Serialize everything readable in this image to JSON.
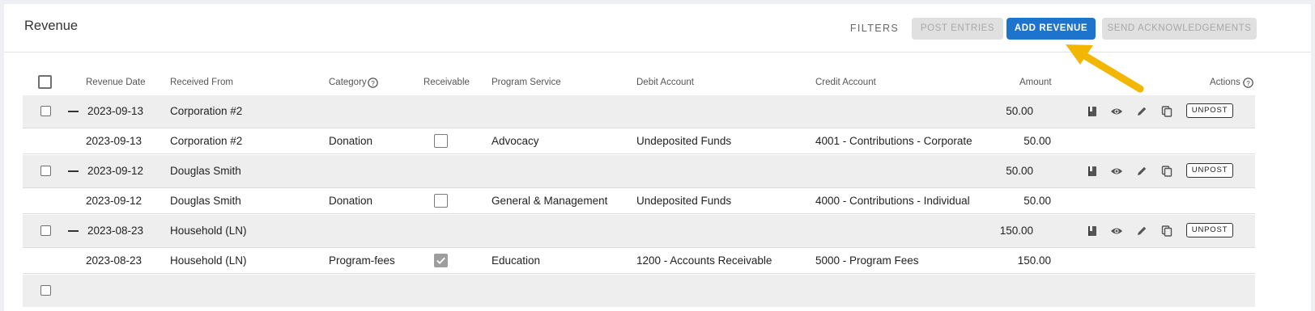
{
  "header": {
    "title": "Revenue",
    "filters_label": "FILTERS",
    "post_entries_label": "POST ENTRIES",
    "add_revenue_label": "ADD REVENUE",
    "send_ack_label": "SEND ACKNOWLEDGEMENTS"
  },
  "table": {
    "columns": {
      "revenue_date": "Revenue Date",
      "received_from": "Received From",
      "category": "Category",
      "receivable": "Receivable",
      "program_service": "Program Service",
      "debit_account": "Debit Account",
      "credit_account": "Credit Account",
      "amount": "Amount",
      "actions": "Actions"
    },
    "unpost_label": "UNPOST",
    "groups": [
      {
        "date": "2023-09-13",
        "from": "Corporation #2",
        "amount": "50.00",
        "detail": {
          "date": "2023-09-13",
          "from": "Corporation #2",
          "category": "Donation",
          "receivable": false,
          "program": "Advocacy",
          "debit": "Undeposited Funds",
          "credit": "4001 - Contributions - Corporate",
          "amount": "50.00"
        }
      },
      {
        "date": "2023-09-12",
        "from": "Douglas Smith",
        "amount": "50.00",
        "detail": {
          "date": "2023-09-12",
          "from": "Douglas Smith",
          "category": "Donation",
          "receivable": false,
          "program": "General & Management",
          "debit": "Undeposited Funds",
          "credit": "4000 - Contributions - Individual",
          "amount": "50.00"
        }
      },
      {
        "date": "2023-08-23",
        "from": "Household (LN)",
        "amount": "150.00",
        "detail": {
          "date": "2023-08-23",
          "from": "Household (LN)",
          "category": "Program-fees",
          "receivable": true,
          "program": "Education",
          "debit": "1200 - Accounts Receivable",
          "credit": "5000 - Program Fees",
          "amount": "150.00"
        }
      }
    ]
  },
  "colors": {
    "accent": "#1e73cc",
    "arrow": "#f2b705",
    "disabled_bg": "#e0e0e0",
    "group_bg": "#eeeeee"
  },
  "icons": [
    "book-icon",
    "eye-icon",
    "pencil-icon",
    "copy-icon",
    "help-circle-icon"
  ]
}
